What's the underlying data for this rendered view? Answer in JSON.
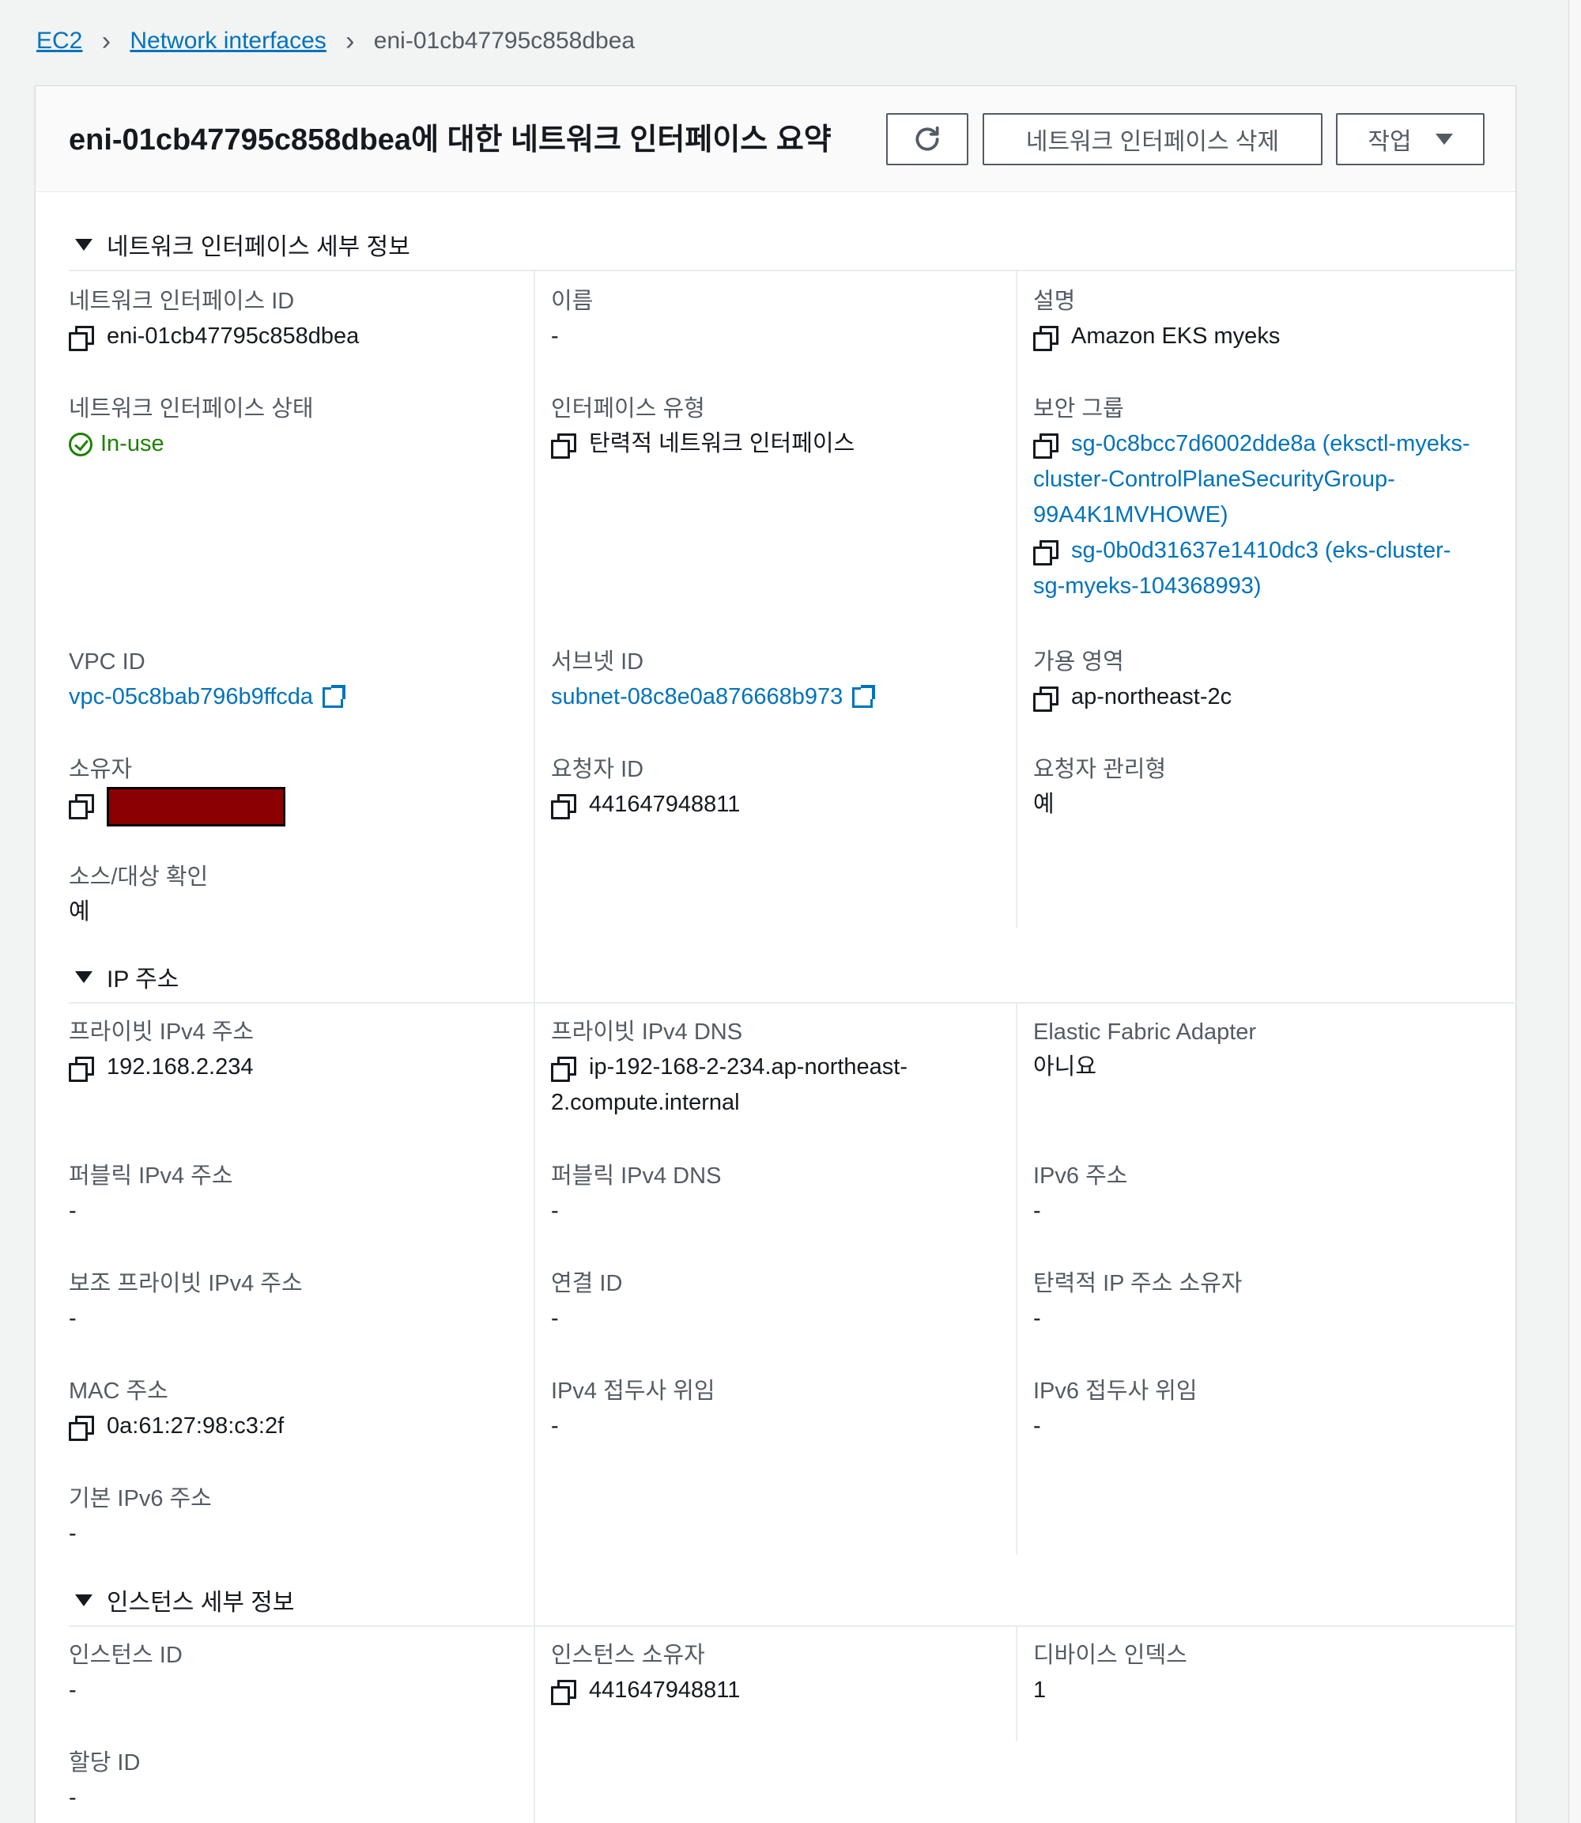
{
  "breadcrumb": {
    "root": "EC2",
    "parent": "Network interfaces",
    "current": "eni-01cb47795c858dbea"
  },
  "header": {
    "title": "eni-01cb47795c858dbea에 대한 네트워크 인터페이스 요약",
    "delete_label": "네트워크 인터페이스 삭제",
    "actions_label": "작업"
  },
  "sections": {
    "details": {
      "heading": "네트워크 인터페이스 세부 정보",
      "eni_id": {
        "label": "네트워크 인터페이스 ID",
        "value": "eni-01cb47795c858dbea"
      },
      "name": {
        "label": "이름",
        "value": "-"
      },
      "description": {
        "label": "설명",
        "value": "Amazon EKS myeks"
      },
      "status": {
        "label": "네트워크 인터페이스 상태",
        "value": "In-use"
      },
      "type": {
        "label": "인터페이스 유형",
        "value": "탄력적 네트워크 인터페이스"
      },
      "security_groups": {
        "label": "보안 그룹",
        "items": [
          {
            "line1": "sg-0c8bcc7d6002dde8a (eksctl-myeks-",
            "line2": "cluster-ControlPlaneSecurityGroup-",
            "line3": "99A4K1MVHOWE)"
          },
          {
            "line1": "sg-0b0d31637e1410dc3 (eks-cluster-",
            "line2": "sg-myeks-104368993)"
          }
        ]
      },
      "vpc_id": {
        "label": "VPC ID",
        "value": "vpc-05c8bab796b9ffcda"
      },
      "subnet_id": {
        "label": "서브넷 ID",
        "value": "subnet-08c8e0a876668b973"
      },
      "az": {
        "label": "가용 영역",
        "value": "ap-northeast-2c"
      },
      "owner": {
        "label": "소유자"
      },
      "requester_id": {
        "label": "요청자 ID",
        "value": "441647948811"
      },
      "requester_managed": {
        "label": "요청자 관리형",
        "value": "예"
      },
      "source_dest": {
        "label": "소스/대상 확인",
        "value": "예"
      }
    },
    "ip": {
      "heading": "IP 주소",
      "private_ipv4": {
        "label": "프라이빗 IPv4 주소",
        "value": "192.168.2.234"
      },
      "private_dns": {
        "label": "프라이빗 IPv4 DNS",
        "line1": "ip-192-168-2-234.ap-northeast-",
        "line2": "2.compute.internal"
      },
      "efa": {
        "label": "Elastic Fabric Adapter",
        "value": "아니요"
      },
      "public_ipv4": {
        "label": "퍼블릭 IPv4 주소",
        "value": "-"
      },
      "public_dns": {
        "label": "퍼블릭 IPv4 DNS",
        "value": "-"
      },
      "ipv6": {
        "label": "IPv6 주소",
        "value": "-"
      },
      "secondary_ipv4": {
        "label": "보조 프라이빗 IPv4 주소",
        "value": "-"
      },
      "association_id": {
        "label": "연결 ID",
        "value": "-"
      },
      "eip_owner": {
        "label": "탄력적 IP 주소 소유자",
        "value": "-"
      },
      "mac": {
        "label": "MAC 주소",
        "value": "0a:61:27:98:c3:2f"
      },
      "ipv4_prefix": {
        "label": "IPv4 접두사 위임",
        "value": "-"
      },
      "ipv6_prefix": {
        "label": "IPv6 접두사 위임",
        "value": "-"
      },
      "primary_ipv6": {
        "label": "기본 IPv6 주소",
        "value": "-"
      }
    },
    "instance": {
      "heading": "인스턴스 세부 정보",
      "instance_id": {
        "label": "인스턴스 ID",
        "value": "-"
      },
      "instance_owner": {
        "label": "인스턴스 소유자",
        "value": "441647948811"
      },
      "device_index": {
        "label": "디바이스 인덱스",
        "value": "1"
      },
      "attachment_id": {
        "label": "할당 ID",
        "value": "-"
      }
    }
  },
  "colors": {
    "link": "#0073bb",
    "status_ok": "#1d8102",
    "redaction": "#8b0000"
  },
  "icons": [
    "chevron-right-icon",
    "refresh-icon",
    "caret-down-icon",
    "copy-icon",
    "check-circle-icon",
    "external-link-icon"
  ]
}
